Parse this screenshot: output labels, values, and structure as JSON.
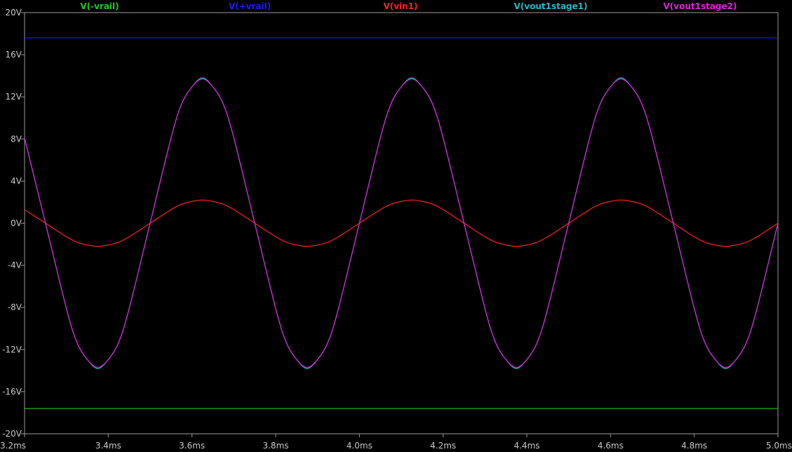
{
  "chart_data": {
    "type": "line",
    "title": "",
    "xlabel": "",
    "ylabel": "",
    "xlim": [
      3.2,
      5.0
    ],
    "ylim": [
      -20,
      20
    ],
    "grid": false,
    "legend_position": "top",
    "x_ticks": [
      3.2,
      3.4,
      3.6,
      3.8,
      4.0,
      4.2,
      4.4,
      4.6,
      4.8,
      5.0
    ],
    "x_tick_labels": [
      "3.2ms",
      "3.4ms",
      "3.6ms",
      "3.8ms",
      "4.0ms",
      "4.2ms",
      "4.4ms",
      "4.6ms",
      "4.8ms",
      "5.0ms"
    ],
    "y_ticks": [
      20,
      16,
      12,
      8,
      4,
      0,
      -4,
      -8,
      -12,
      -16,
      -20
    ],
    "y_tick_labels": [
      "20V",
      "16V",
      "12V",
      "8V",
      "4V",
      "0V",
      "-4V",
      "-8V",
      "-12V",
      "-16V",
      "-20V"
    ],
    "series": [
      {
        "name": "V(-vrail)",
        "color": "#22c722",
        "x": [
          3.2,
          5.0
        ],
        "y": [
          -17.6,
          -17.6
        ]
      },
      {
        "name": "V(+vrail)",
        "color": "#1a1aff",
        "x": [
          3.2,
          5.0
        ],
        "y": [
          17.6,
          17.6
        ]
      },
      {
        "name": "V(vin1)",
        "color": "#ff2020",
        "x": [
          3.2,
          3.25,
          3.3,
          3.325,
          3.35,
          3.375,
          3.4,
          3.425,
          3.45,
          3.5,
          3.55,
          3.575,
          3.6,
          3.625,
          3.65,
          3.675,
          3.7,
          3.75,
          3.8,
          3.825,
          3.85,
          3.875,
          3.9,
          3.925,
          3.95,
          4.0,
          4.05,
          4.075,
          4.1,
          4.125,
          4.15,
          4.175,
          4.2,
          4.25,
          4.3,
          4.325,
          4.35,
          4.375,
          4.4,
          4.425,
          4.45,
          4.5,
          4.55,
          4.575,
          4.6,
          4.625,
          4.65,
          4.675,
          4.7,
          4.75,
          4.8,
          4.825,
          4.85,
          4.875,
          4.9,
          4.925,
          4.95,
          5.0
        ],
        "y": [
          1.29,
          0.0,
          -1.29,
          -1.8,
          -2.07,
          -2.2,
          -2.07,
          -1.8,
          -1.29,
          0.0,
          1.29,
          1.8,
          2.07,
          2.2,
          2.07,
          1.8,
          1.29,
          0.0,
          -1.29,
          -1.8,
          -2.07,
          -2.2,
          -2.07,
          -1.8,
          -1.29,
          0.0,
          1.29,
          1.8,
          2.07,
          2.2,
          2.07,
          1.8,
          1.29,
          0.0,
          -1.29,
          -1.8,
          -2.07,
          -2.2,
          -2.07,
          -1.8,
          -1.29,
          0.0,
          1.29,
          1.8,
          2.07,
          2.2,
          2.07,
          1.8,
          1.29,
          0.0,
          -1.29,
          -1.8,
          -2.07,
          -2.2,
          -2.07,
          -1.8,
          -1.29,
          0.0
        ]
      },
      {
        "name": "V(vout1stage1)",
        "color": "#22b8c8",
        "x": [
          3.2,
          3.25,
          3.3,
          3.325,
          3.35,
          3.375,
          3.4,
          3.425,
          3.45,
          3.5,
          3.55,
          3.575,
          3.6,
          3.625,
          3.65,
          3.675,
          3.7,
          3.75,
          3.8,
          3.825,
          3.85,
          3.875,
          3.9,
          3.925,
          3.95,
          4.0,
          4.05,
          4.075,
          4.1,
          4.125,
          4.15,
          4.175,
          4.2,
          4.25,
          4.3,
          4.325,
          4.35,
          4.375,
          4.4,
          4.425,
          4.45,
          4.5,
          4.55,
          4.575,
          4.6,
          4.625,
          4.65,
          4.675,
          4.7,
          4.75,
          4.8,
          4.825,
          4.85,
          4.875,
          4.9,
          4.925,
          4.95,
          5.0
        ],
        "y": [
          8.1,
          0.0,
          -8.1,
          -11.3,
          -12.95,
          -13.8,
          -12.95,
          -11.3,
          -8.1,
          0.0,
          8.1,
          11.3,
          12.95,
          13.8,
          12.95,
          11.3,
          8.1,
          0.0,
          -8.1,
          -11.3,
          -12.95,
          -13.8,
          -12.95,
          -11.3,
          -8.1,
          0.0,
          8.1,
          11.3,
          12.95,
          13.8,
          12.95,
          11.3,
          8.1,
          0.0,
          -8.1,
          -11.3,
          -12.95,
          -13.8,
          -12.95,
          -11.3,
          -8.1,
          0.0,
          8.1,
          11.3,
          12.95,
          13.8,
          12.95,
          11.3,
          8.1,
          0.0,
          -8.1,
          -11.3,
          -12.95,
          -13.8,
          -12.95,
          -11.3,
          -8.1,
          0.0
        ]
      },
      {
        "name": "V(vout1stage2)",
        "color": "#e020e0",
        "x": [
          3.2,
          3.25,
          3.3,
          3.325,
          3.35,
          3.375,
          3.4,
          3.425,
          3.45,
          3.5,
          3.55,
          3.575,
          3.6,
          3.625,
          3.65,
          3.675,
          3.7,
          3.75,
          3.8,
          3.825,
          3.85,
          3.875,
          3.9,
          3.925,
          3.95,
          4.0,
          4.05,
          4.075,
          4.1,
          4.125,
          4.15,
          4.175,
          4.2,
          4.25,
          4.3,
          4.325,
          4.35,
          4.375,
          4.4,
          4.425,
          4.45,
          4.5,
          4.55,
          4.575,
          4.6,
          4.625,
          4.65,
          4.675,
          4.7,
          4.75,
          4.8,
          4.825,
          4.85,
          4.875,
          4.9,
          4.925,
          4.95,
          5.0
        ],
        "y": [
          8.1,
          0.0,
          -8.1,
          -11.3,
          -12.95,
          -13.7,
          -12.95,
          -11.3,
          -8.1,
          0.0,
          8.1,
          11.3,
          12.95,
          13.7,
          12.95,
          11.3,
          8.1,
          0.0,
          -8.1,
          -11.3,
          -12.95,
          -13.7,
          -12.95,
          -11.3,
          -8.1,
          0.0,
          8.1,
          11.3,
          12.95,
          13.7,
          12.95,
          11.3,
          8.1,
          0.0,
          -8.1,
          -11.3,
          -12.95,
          -13.7,
          -12.95,
          -11.3,
          -8.1,
          0.0,
          8.1,
          11.3,
          12.95,
          13.7,
          12.95,
          11.3,
          8.1,
          0.0,
          -8.1,
          -11.3,
          -12.95,
          -13.7,
          -12.95,
          -11.3,
          -8.1,
          0.0
        ]
      }
    ]
  }
}
